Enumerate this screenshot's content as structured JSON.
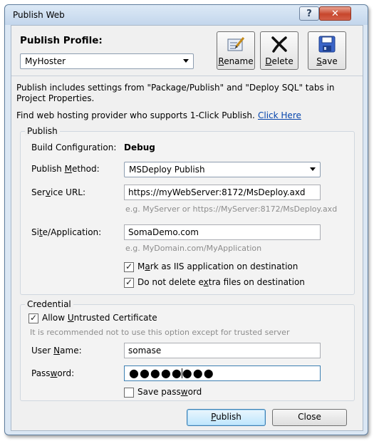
{
  "window": {
    "title": "Publish Web",
    "help_glyph": "?",
    "close_glyph": "✕"
  },
  "profile": {
    "label": "Publish Profile:",
    "selected": "MyHoster",
    "buttons": {
      "rename": "Rename",
      "delete": "Delete",
      "save": "Save"
    }
  },
  "info": {
    "line1": "Publish includes settings from \"Package/Publish\" and \"Deploy SQL\" tabs in",
    "line2": "Project Properties.",
    "hosting_text": "Find web hosting provider who supports 1-Click Publish.",
    "hosting_link": "Click Here"
  },
  "publish": {
    "group_label": "Publish",
    "build_config_label": "Build Configuration:",
    "build_config_value": "Debug",
    "method_label": "Publish Method:",
    "method_value": "MSDeploy Publish",
    "service_url_label": "Service URL:",
    "service_url_value": "https://myWebServer:8172/MsDeploy.axd",
    "service_url_hint": "e.g. MyServer or https://MyServer:8172/MsDeploy.axd",
    "site_label": "Site/Application:",
    "site_value": "SomaDemo.com",
    "site_hint": "e.g. MyDomain.com/MyApplication",
    "mark_iis_label": "Mark as IIS application on destination",
    "mark_iis_checked": true,
    "no_delete_label": "Do not delete extra files on destination",
    "no_delete_checked": true
  },
  "credential": {
    "group_label": "Credential",
    "untrusted_label": "Allow Untrusted Certificate",
    "untrusted_checked": true,
    "untrusted_hint": "It is recommended not to use this option except for trusted server",
    "username_label": "User Name:",
    "username_value": "somase",
    "password_label": "Password:",
    "password_mask": "●●●●●●●●",
    "save_password_label": "Save password",
    "save_password_checked": false
  },
  "footer": {
    "publish": "Publish",
    "close": "Close"
  },
  "colors": {
    "link": "#0645ad",
    "hint": "#8c8c8c",
    "close_button": "#c7462c"
  }
}
